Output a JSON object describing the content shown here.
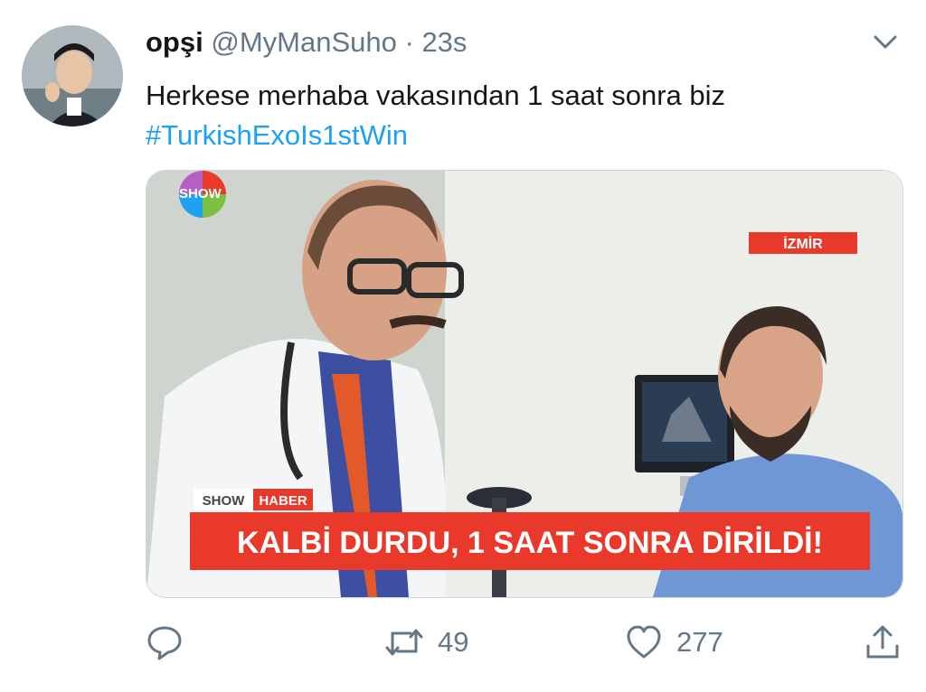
{
  "tweet": {
    "display_name": "opşi",
    "handle": "@MyManSuho",
    "separator": "·",
    "time": "23s",
    "text_line": "Herkese merhaba vakasından 1 saat sonra biz",
    "hashtag": "#TurkishExoIs1stWin"
  },
  "media": {
    "channel_logo": "SHOW",
    "location_tag": "İZMİR",
    "ticker_show": "SHOW",
    "ticker_haber": "HABER",
    "headline": "KALBİ DURDU, 1 SAAT SONRA DİRİLDİ!"
  },
  "actions": {
    "reply_icon": "reply-icon",
    "retweet_icon": "retweet-icon",
    "retweet_count": "49",
    "like_icon": "heart-icon",
    "like_count": "277",
    "share_icon": "share-icon"
  },
  "colors": {
    "text": "#14171a",
    "secondary": "#657786",
    "link": "#1da1f2",
    "banner_red": "#e8392b",
    "banner_text": "#ffffff"
  }
}
